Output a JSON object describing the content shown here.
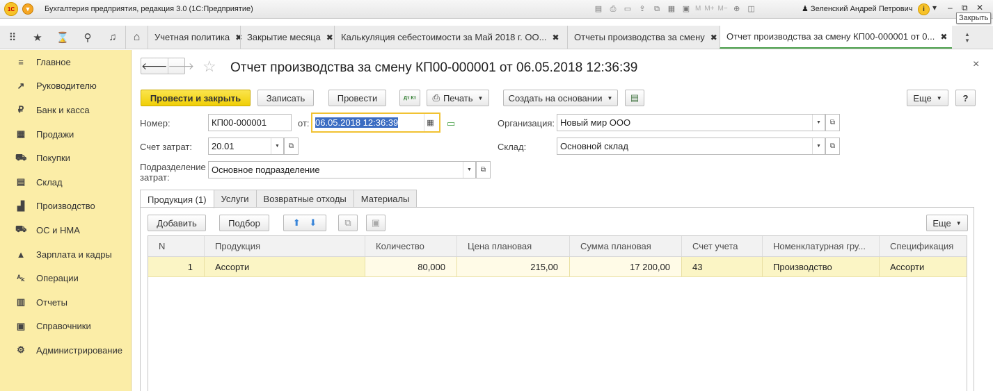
{
  "app": {
    "logo_text": "1С",
    "title": "Бухгалтерия предприятия, редакция 3.0  (1С:Предприятие)",
    "toolbar_text": [
      "M",
      "M+",
      "M−"
    ],
    "user": "Зеленский Андрей Петрович",
    "tooltip": "Закрыть"
  },
  "tabs": [
    {
      "label": "Учетная политика"
    },
    {
      "label": "Закрытие месяца"
    },
    {
      "label": "Калькуляция себестоимости за Май 2018 г. ОО..."
    },
    {
      "label": "Отчеты производства за смену"
    },
    {
      "label": "Отчет производства за смену КП00-000001 от 0..."
    }
  ],
  "sidebar": {
    "items": [
      {
        "label": "Главное",
        "icon": "≡"
      },
      {
        "label": "Руководителю",
        "icon": "↗"
      },
      {
        "label": "Банк и касса",
        "icon": "₽"
      },
      {
        "label": "Продажи",
        "icon": "▦"
      },
      {
        "label": "Покупки",
        "icon": "⛟"
      },
      {
        "label": "Склад",
        "icon": "▤"
      },
      {
        "label": "Производство",
        "icon": "▟"
      },
      {
        "label": "ОС и НМА",
        "icon": "⛟"
      },
      {
        "label": "Зарплата и кадры",
        "icon": "▲"
      },
      {
        "label": "Операции",
        "icon": "ᴬₖ"
      },
      {
        "label": "Отчеты",
        "icon": "▥"
      },
      {
        "label": "Справочники",
        "icon": "▣"
      },
      {
        "label": "Администрирование",
        "icon": "⚙"
      }
    ]
  },
  "form": {
    "title": "Отчет производства за смену КП00-000001 от 06.05.2018 12:36:39",
    "buttons": {
      "post_close": "Провести и закрыть",
      "save": "Записать",
      "post": "Провести",
      "dtkt": "Дт Кт",
      "print": "Печать",
      "create_based": "Создать на основании",
      "more": "Еще",
      "help": "?"
    },
    "fields": {
      "number_label": "Номер:",
      "number": "КП00-000001",
      "date_label": "от:",
      "date": "06.05.2018 12:36:39",
      "org_label": "Организация:",
      "org": "Новый мир ООО",
      "account_label": "Счет затрат:",
      "account": "20.01",
      "warehouse_label": "Склад:",
      "warehouse": "Основной склад",
      "division_label_1": "Подразделение",
      "division_label_2": "затрат:",
      "division": "Основное подразделение"
    },
    "inner_tabs": [
      "Продукция (1)",
      "Услуги",
      "Возвратные отходы",
      "Материалы"
    ],
    "table_buttons": {
      "add": "Добавить",
      "pick": "Подбор",
      "more": "Еще"
    },
    "table": {
      "headers": [
        "N",
        "Продукция",
        "Количество",
        "Цена плановая",
        "Сумма плановая",
        "Счет учета",
        "Номенклатурная гру...",
        "Спецификация"
      ],
      "rows": [
        [
          "1",
          "Ассорти",
          "80,000",
          "215,00",
          "17 200,00",
          "43",
          "Производство",
          "Ассорти"
        ]
      ]
    }
  }
}
